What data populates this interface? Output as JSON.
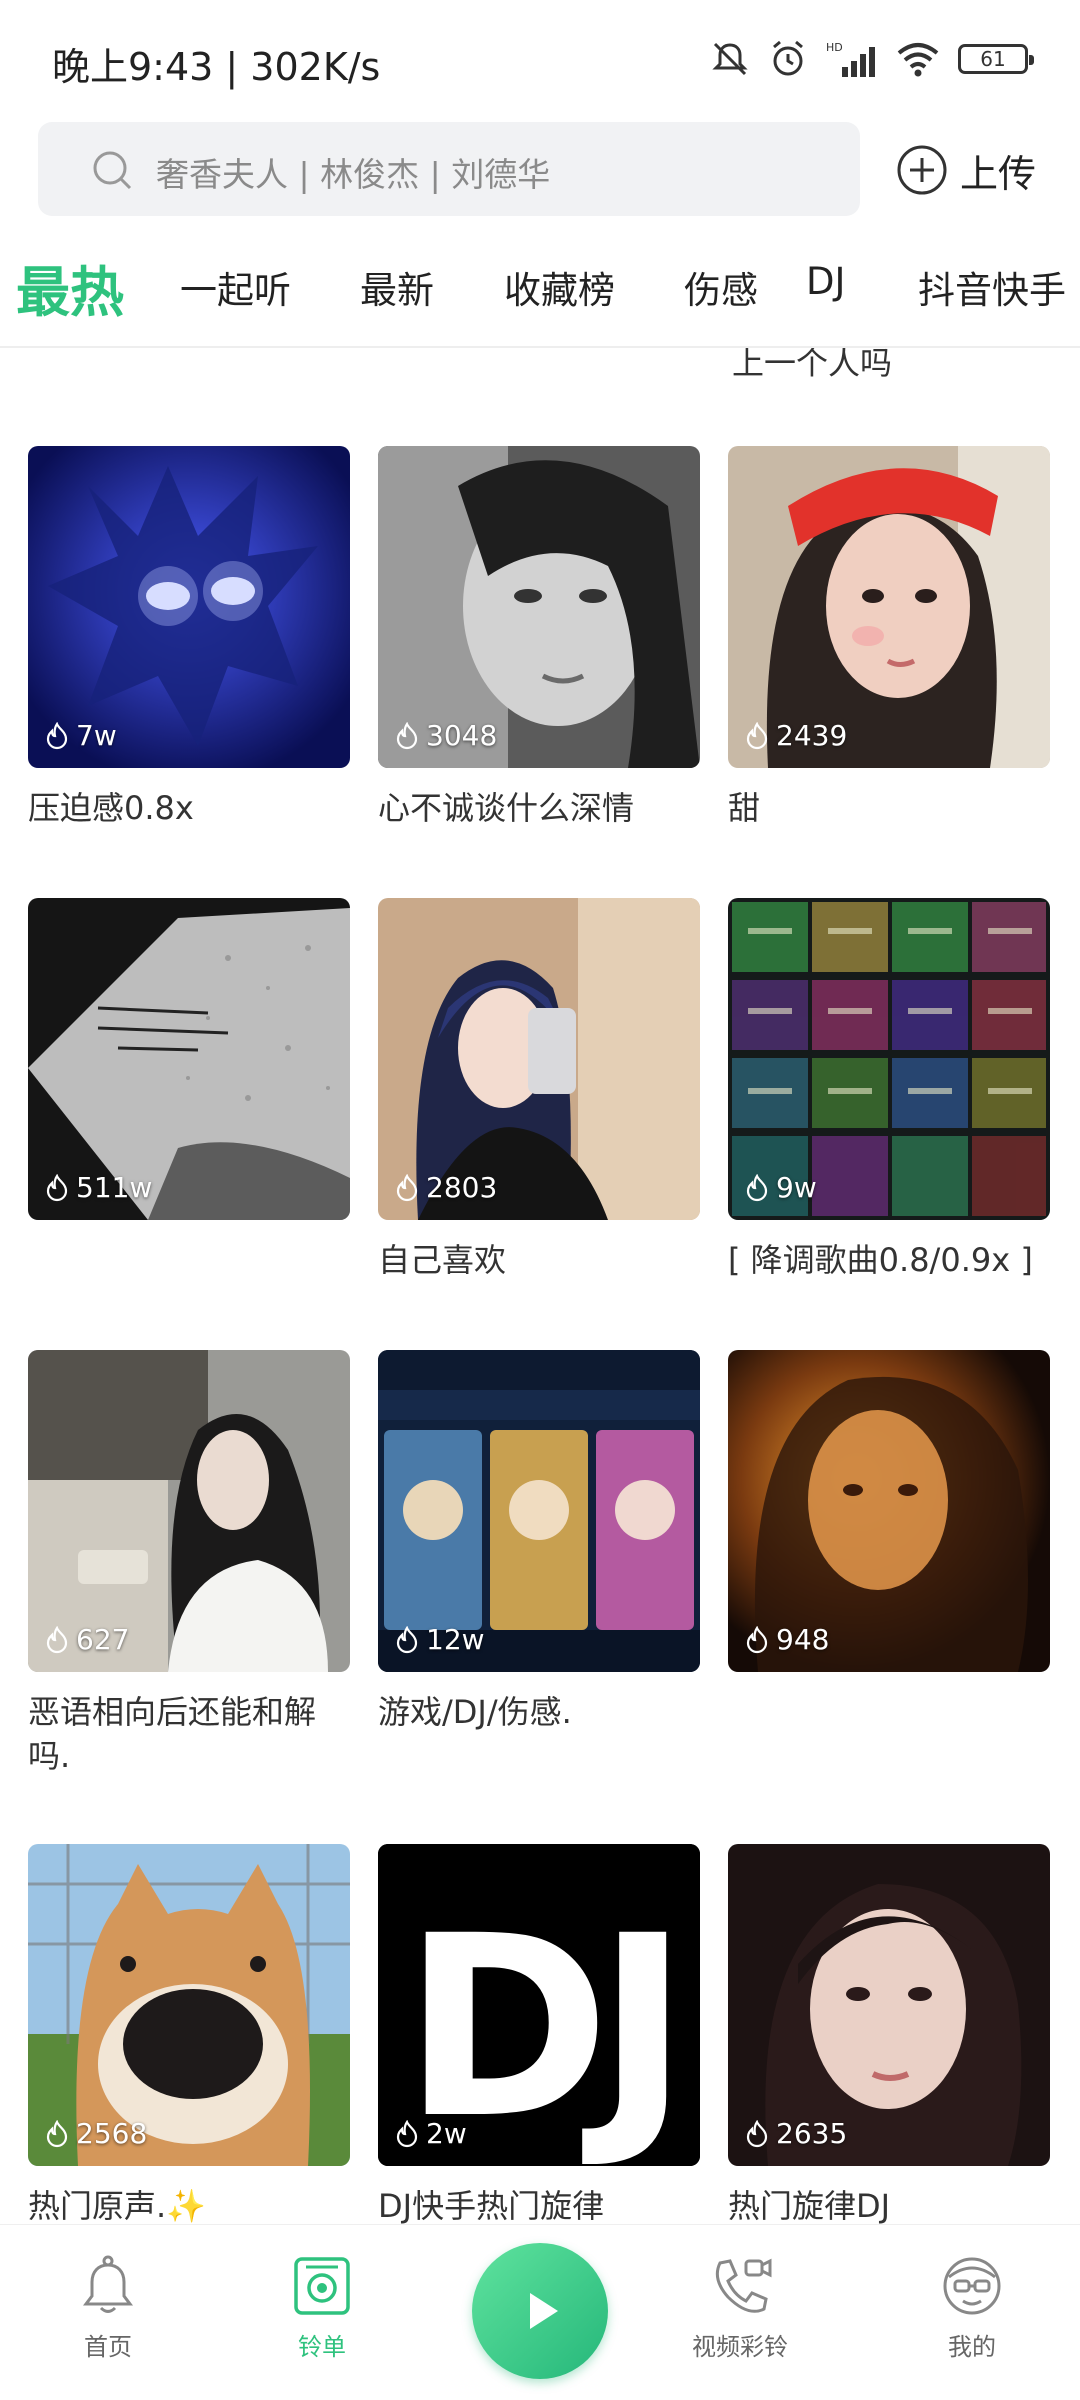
{
  "status_bar": {
    "time": "晚上9:43 | 302K/s",
    "battery": "61",
    "network_label": "HD"
  },
  "search": {
    "placeholder": "奢香夫人 | 林俊杰 | 刘德华",
    "upload_label": "上传"
  },
  "tabs": [
    {
      "label": "最热",
      "active": true
    },
    {
      "label": "一起听"
    },
    {
      "label": "最新"
    },
    {
      "label": "收藏榜"
    },
    {
      "label": "伤感"
    },
    {
      "label": "DJ"
    },
    {
      "label": "抖音快手"
    }
  ],
  "partial_title": "上一个人吗",
  "playlists": [
    {
      "title": "压迫感0.8x",
      "heat": "7w",
      "thumb_icon": "anime-boy-icon"
    },
    {
      "title": "心不诚谈什么深情",
      "heat": "3048",
      "thumb_icon": "portrait-icon"
    },
    {
      "title": "甜",
      "heat": "2439",
      "thumb_icon": "portrait-icon"
    },
    {
      "title": "",
      "heat": "511w",
      "thumb_icon": "rainy-window-icon"
    },
    {
      "title": "自己喜欢",
      "heat": "2803",
      "thumb_icon": "selfie-icon"
    },
    {
      "title": "[ 降调歌曲0.8/0.9x ]",
      "heat": "9w",
      "thumb_icon": "music-grid-icon"
    },
    {
      "title": "恶语相向后还能和解吗.",
      "heat": "627",
      "thumb_icon": "portrait-icon"
    },
    {
      "title": "游戏/DJ/伤感.",
      "heat": "12w",
      "thumb_icon": "game-heroes-icon"
    },
    {
      "title": "",
      "heat": "948",
      "thumb_icon": "portrait-icon"
    },
    {
      "title": "热门原声.✨",
      "heat": "2568",
      "thumb_icon": "dog-icon"
    },
    {
      "title": "DJ快手热门旋律",
      "heat": "2w",
      "thumb_icon": "dj-logo-icon",
      "thumb_text": "DJ"
    },
    {
      "title": "热门旋律DJ",
      "heat": "2635",
      "thumb_icon": "portrait-icon"
    }
  ],
  "bottom_nav": [
    {
      "label": "首页",
      "icon": "bell-icon"
    },
    {
      "label": "铃单",
      "icon": "ringlist-icon",
      "active": true
    },
    {
      "label": "",
      "icon": "play-icon"
    },
    {
      "label": "视频彩铃",
      "icon": "video-call-icon"
    },
    {
      "label": "我的",
      "icon": "profile-icon"
    }
  ],
  "colors": {
    "accent": "#2ec27e",
    "search_bg": "#f1f2f4",
    "text": "#222222",
    "muted": "#8a8a8a"
  }
}
